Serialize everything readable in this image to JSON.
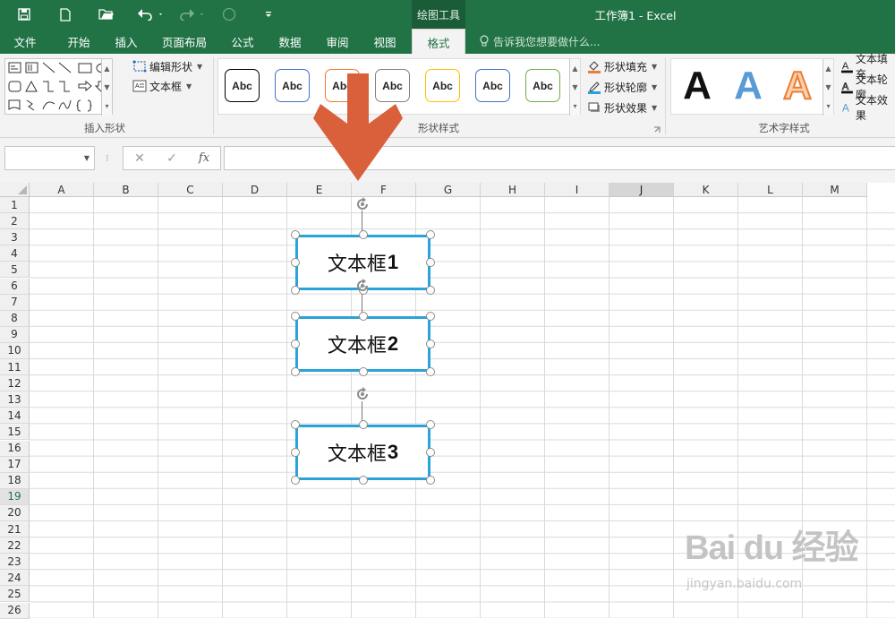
{
  "window": {
    "contextual_tab_group": "绘图工具",
    "title": "工作簿1 - Excel"
  },
  "tabs": [
    {
      "label": "文件"
    },
    {
      "label": "开始"
    },
    {
      "label": "插入"
    },
    {
      "label": "页面布局"
    },
    {
      "label": "公式"
    },
    {
      "label": "数据"
    },
    {
      "label": "审阅"
    },
    {
      "label": "视图"
    },
    {
      "label": "格式",
      "active": true
    }
  ],
  "tell_me": "告诉我您想要做什么...",
  "ribbon": {
    "insert_shapes": {
      "edit_shape": "编辑形状",
      "text_box": "文本框",
      "label": "插入形状"
    },
    "shape_styles": {
      "samples": [
        {
          "text": "Abc",
          "border": "#000000"
        },
        {
          "text": "Abc",
          "border": "#4472c4"
        },
        {
          "text": "Abc",
          "border": "#ed7d31"
        },
        {
          "text": "Abc",
          "border": "#808080"
        },
        {
          "text": "Abc",
          "border": "#ffc000"
        },
        {
          "text": "Abc",
          "border": "#4472c4"
        },
        {
          "text": "Abc",
          "border": "#70ad47"
        }
      ],
      "fill": "形状填充",
      "outline": "形状轮廓",
      "effects": "形状效果",
      "label": "形状样式"
    },
    "wordart_styles": {
      "samples": [
        {
          "text": "A",
          "style": "black"
        },
        {
          "text": "A",
          "style": "blue-gradient"
        },
        {
          "text": "A",
          "style": "orange-outline"
        }
      ],
      "text_fill": "文本填充",
      "text_outline": "文本轮廓",
      "text_effects": "文本效果",
      "label": "艺术字样式"
    }
  },
  "formula_bar": {
    "name_box": "",
    "cancel": "✕",
    "enter": "✓",
    "fx": "fx",
    "value": ""
  },
  "sheet": {
    "columns": [
      "A",
      "B",
      "C",
      "D",
      "E",
      "F",
      "G",
      "H",
      "I",
      "J",
      "K",
      "L",
      "M"
    ],
    "selected_column": "J",
    "rows": [
      "1",
      "2",
      "3",
      "4",
      "5",
      "6",
      "7",
      "8",
      "9",
      "10",
      "11",
      "12",
      "13",
      "14",
      "15",
      "16",
      "17",
      "18",
      "19",
      "20",
      "21",
      "22",
      "23",
      "24",
      "25",
      "26"
    ],
    "selected_row": "19"
  },
  "text_boxes": [
    {
      "prefix": "文本框",
      "number": "1"
    },
    {
      "prefix": "文本框",
      "number": "2"
    },
    {
      "prefix": "文本框",
      "number": "3"
    }
  ],
  "annotation": {
    "color": "#d9603b"
  },
  "watermark": {
    "main": "Bai du 经验",
    "sub": "jingyan.baidu.com"
  },
  "colors": {
    "excel_green": "#217346",
    "shape_outline": "#2aa3d8"
  }
}
